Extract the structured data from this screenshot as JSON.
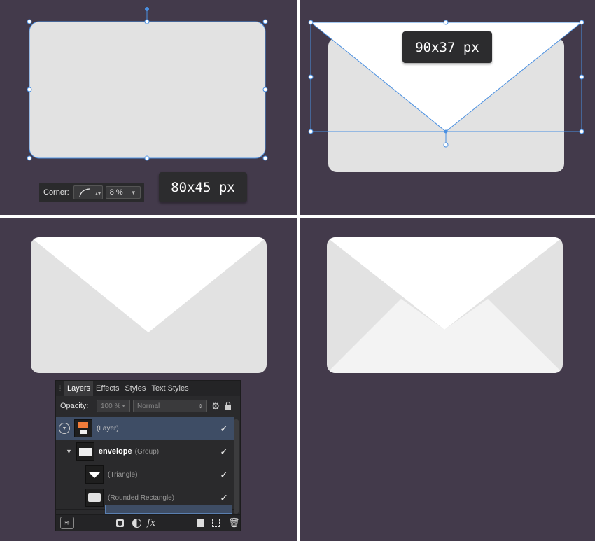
{
  "panels": {
    "p1": {
      "dimension_label": "80x45 px",
      "corner_toolbar": {
        "label": "Corner:",
        "value": "8 %"
      }
    },
    "p2": {
      "dimension_label": "90x37 px"
    }
  },
  "layers_panel": {
    "tabs": [
      "Layers",
      "Effects",
      "Styles",
      "Text Styles"
    ],
    "active_tab": "Layers",
    "opacity": {
      "label": "Opacity:",
      "value": "100 %"
    },
    "blend_mode": "Normal",
    "rows": [
      {
        "name": "(Layer)",
        "visible": true,
        "selected": true
      },
      {
        "name": "envelope",
        "type": "(Group)",
        "visible": true
      },
      {
        "name": "(Triangle)",
        "visible": true
      },
      {
        "name": "(Rounded Rectangle)",
        "visible": true
      }
    ],
    "footer_icons": [
      "layers-icon",
      "mask-icon",
      "adjustment-icon",
      "fx-icon",
      "new-page-icon",
      "new-layer-icon",
      "trash-icon"
    ],
    "fx_label": "fx"
  },
  "colors": {
    "canvas_bg": "#433a4b",
    "shape_light": "#e2e2e2",
    "shape_white": "#ffffff",
    "selection_blue": "#4a90e2"
  }
}
